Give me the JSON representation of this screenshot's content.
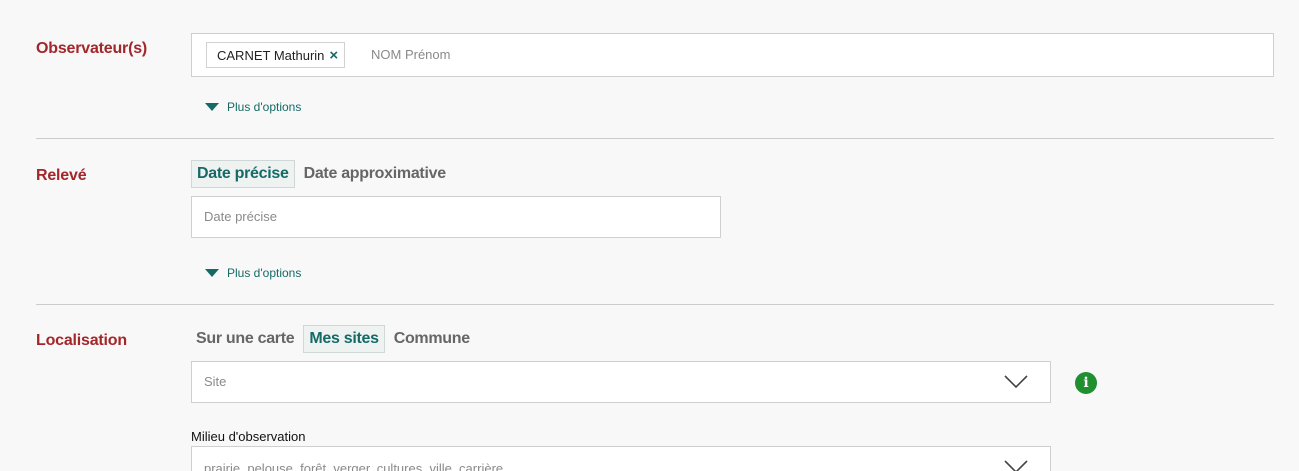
{
  "observers": {
    "label": "Observateur(s)",
    "tag_name": "CARNET Mathurin",
    "tag_remove": "×",
    "input_placeholder": "NOM Prénom",
    "more_options": "Plus d'options"
  },
  "releve": {
    "label": "Relevé",
    "tabs": [
      {
        "label": "Date précise",
        "active": true
      },
      {
        "label": "Date approximative",
        "active": false
      }
    ],
    "date_placeholder": "Date précise",
    "more_options": "Plus d'options"
  },
  "localisation": {
    "label": "Localisation",
    "tabs": [
      {
        "label": "Sur une carte",
        "active": false
      },
      {
        "label": "Mes sites",
        "active": true
      },
      {
        "label": "Commune",
        "active": false
      }
    ],
    "site_placeholder": "Site",
    "info_icon_text": "i",
    "milieu_label": "Milieu d'observation",
    "milieu_placeholder": "prairie, pelouse, forêt, verger, cultures, ville, carrière..."
  },
  "colors": {
    "section_label": "#a3262b",
    "accent": "#156a66",
    "info_green": "#1f8f2f"
  }
}
